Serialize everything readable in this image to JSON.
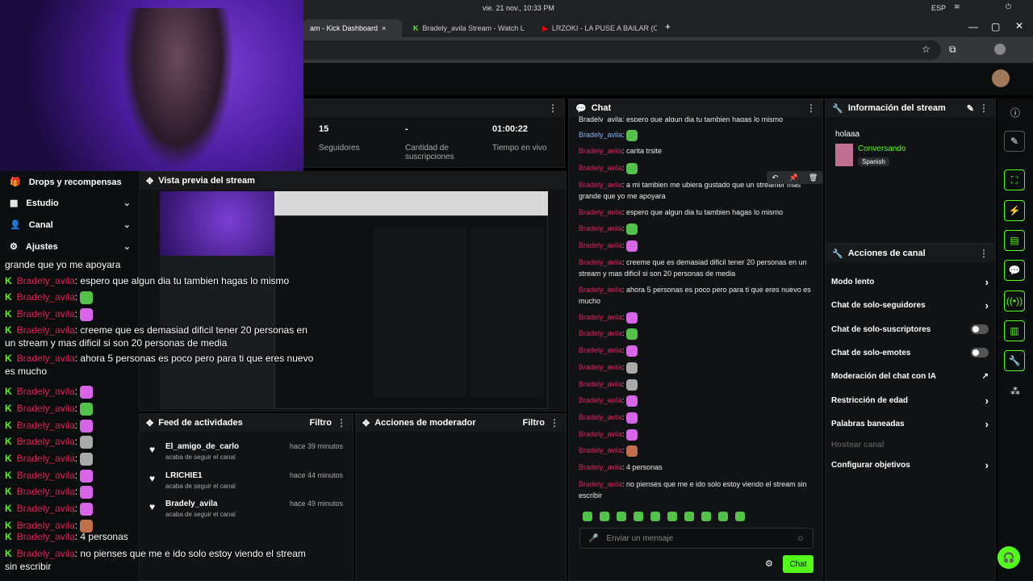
{
  "system": {
    "datetime": "vie. 21 nov., 10:33 PM",
    "lang": "ESP"
  },
  "tabs": [
    {
      "label": "am - Kick Dashboard",
      "icon": "kick-icon"
    },
    {
      "label": "Bradely_avila Stream - Watch L",
      "icon": "kick-icon"
    },
    {
      "label": "LRZOKI - LA PUSE A BAILAR (O",
      "icon": "youtube-icon"
    }
  ],
  "stats": [
    {
      "value": "15",
      "label": "Seguidores"
    },
    {
      "value": "-",
      "label": "Cantidad de suscripciones"
    },
    {
      "value": "01:00:22",
      "label": "Tiempo en vivo"
    }
  ],
  "nav": [
    {
      "label": "Drops y recompensas",
      "icon": "gift-icon"
    },
    {
      "label": "Estudio",
      "icon": "grid-icon"
    },
    {
      "label": "Canal",
      "icon": "user-icon"
    },
    {
      "label": "Ajustes",
      "icon": "gear-icon"
    }
  ],
  "preview": {
    "title": "Vista previa del stream"
  },
  "feed": {
    "title": "Feed de actividades",
    "filter": "Filtro",
    "items": [
      {
        "user": "El_amigo_de_carlo",
        "sub": "acaba de seguir el canal",
        "time": "hace 39 minutos"
      },
      {
        "user": "LRICHIE1",
        "sub": "acaba de seguir el canal",
        "time": "hace 44 minutos"
      },
      {
        "user": "Bradely_avila",
        "sub": "acaba de seguir el canal",
        "time": "hace 49 minutos"
      }
    ]
  },
  "mod": {
    "title": "Acciones de moderador",
    "filter": "Filtro"
  },
  "chat": {
    "title": "Chat",
    "top_line": "Bradely_avila: espero que algun dia tu tambien hagas lo mismo",
    "messages": [
      {
        "user": "Bradely_avila",
        "text": "",
        "emote": "green",
        "alt": true
      },
      {
        "user": "Bradely_avila",
        "text": "carita trsite",
        "emote": ""
      },
      {
        "user": "Bradely_avila",
        "text": "",
        "emote": "green"
      },
      {
        "user": "Bradely_avila",
        "text": "a mi tambien me ubiera gustado que un streamer mas grande que yo me apoyara",
        "emote": ""
      },
      {
        "user": "Bradely_avila",
        "text": "espero que algun dia tu tambien hagas lo mismo",
        "emote": ""
      },
      {
        "user": "Bradely_avila",
        "text": "",
        "emote": "green"
      },
      {
        "user": "Bradely_avila",
        "text": "",
        "emote": "pink"
      },
      {
        "user": "Bradely_avila",
        "text": "creeme que es demasiad dificil tener 20 personas en un stream y mas dificil si son 20 personas de media",
        "emote": ""
      },
      {
        "user": "Bradely_avila",
        "text": "ahora 5 personas es poco pero para ti que eres nuevo es mucho",
        "emote": ""
      },
      {
        "user": "Bradely_avila",
        "text": "",
        "emote": "pink"
      },
      {
        "user": "Bradely_avila",
        "text": "",
        "emote": "green"
      },
      {
        "user": "Bradely_avila",
        "text": "",
        "emote": "pink"
      },
      {
        "user": "Bradely_avila",
        "text": "",
        "emote": "cat"
      },
      {
        "user": "Bradely_avila",
        "text": "",
        "emote": "cat"
      },
      {
        "user": "Bradely_avila",
        "text": "",
        "emote": "pink"
      },
      {
        "user": "Bradely_avila",
        "text": "",
        "emote": "pink"
      },
      {
        "user": "Bradely_avila",
        "text": "",
        "emote": "pink"
      },
      {
        "user": "Bradely_avila",
        "text": "",
        "emote": "face"
      },
      {
        "user": "Bradely_avila",
        "text": "4 personas",
        "emote": ""
      },
      {
        "user": "Bradely_avila",
        "text": "no pienses que me e ido solo estoy viendo el stream sin escribir",
        "emote": ""
      }
    ],
    "input_placeholder": "Enviar un mensaje",
    "send_label": "Chat"
  },
  "overlay": {
    "first": "grande que yo me apoyara",
    "lines": [
      {
        "user": "Bradely_avila",
        "text": "espero que algun dia tu tambien hagas lo mismo",
        "emote": ""
      },
      {
        "user": "Bradely_avila",
        "text": "",
        "emote": "green"
      },
      {
        "user": "Bradely_avila",
        "text": "",
        "emote": "pink"
      },
      {
        "user": "Bradely_avila",
        "text": "creeme que es demasiad dificil tener 20 personas en un stream y mas dificil si son 20 personas de media",
        "emote": ""
      },
      {
        "user": "Bradely_avila",
        "text": "ahora 5 personas es poco pero para ti que eres nuevo es mucho",
        "emote": ""
      },
      {
        "user": "Bradely_avila",
        "text": "",
        "emote": "pink"
      },
      {
        "user": "Bradely_avila",
        "text": "",
        "emote": "green"
      },
      {
        "user": "Bradely_avila",
        "text": "",
        "emote": "pink"
      },
      {
        "user": "Bradely_avila",
        "text": "",
        "emote": "cat"
      },
      {
        "user": "Bradely_avila",
        "text": "",
        "emote": "cat"
      },
      {
        "user": "Bradely_avila",
        "text": "",
        "emote": "pink"
      },
      {
        "user": "Bradely_avila",
        "text": "",
        "emote": "pink"
      },
      {
        "user": "Bradely_avila",
        "text": "",
        "emote": "pink"
      },
      {
        "user": "Bradely_avila",
        "text": "",
        "emote": "face"
      },
      {
        "user": "Bradely_avila",
        "text": "4 personas",
        "emote": ""
      },
      {
        "user": "Bradely_avila",
        "text": "no pienses que me e ido solo estoy viendo el stream sin escribir",
        "emote": ""
      }
    ]
  },
  "info": {
    "title": "Información del stream",
    "stream_title": "holaaa",
    "category": "Conversando",
    "tag": "Spanish"
  },
  "actions": {
    "title": "Acciones de canal",
    "items": [
      {
        "label": "Modo lento",
        "control": "chevron"
      },
      {
        "label": "Chat de solo-seguidores",
        "control": "chevron"
      },
      {
        "label": "Chat de solo-suscriptores",
        "control": "toggle"
      },
      {
        "label": "Chat de solo-emotes",
        "control": "toggle"
      },
      {
        "label": "Moderación del chat con IA",
        "control": "external"
      },
      {
        "label": "Restricción de edad",
        "control": "chevron"
      },
      {
        "label": "Palabras baneadas",
        "control": "chevron"
      },
      {
        "label": "Hostear canal",
        "control": "disabled"
      },
      {
        "label": "Configurar objetivos",
        "control": "chevron"
      }
    ]
  },
  "colors": {
    "accent": "#53fc18",
    "username": "#e0245e"
  }
}
